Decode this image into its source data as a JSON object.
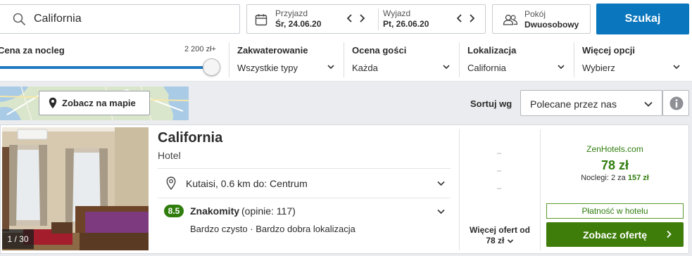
{
  "search": {
    "destination": "California"
  },
  "dates": {
    "checkin_label": "Przyjazd",
    "checkin_value": "Śr, 24.06.20",
    "checkout_label": "Wyjazd",
    "checkout_value": "Pt, 26.06.20"
  },
  "rooms": {
    "label": "Pokój",
    "value": "Dwuosobowy"
  },
  "search_button": "Szukaj",
  "filters": {
    "price_label": "Cena za nocleg",
    "price_max": "2 200 zł+",
    "price_slider_fraction": 1.0,
    "accommodation": {
      "title": "Zakwaterowanie",
      "value": "Wszystkie typy"
    },
    "rating": {
      "title": "Ocena gości",
      "value": "Każda"
    },
    "location": {
      "title": "Lokalizacja",
      "value": "California"
    },
    "more": {
      "title": "Więcej opcji",
      "value": "Wybierz"
    }
  },
  "map": {
    "button_label": "Zobacz na mapie"
  },
  "sort": {
    "label": "Sortuj wg",
    "value": "Polecane przez nas"
  },
  "hotel": {
    "name": "California",
    "type": "Hotel",
    "photo_counter": "1 / 30",
    "location": "Kutaisi, 0.6 km do: Centrum",
    "score": "8.5",
    "rating_word": "Znakomity",
    "rating_count": "(opinie: 117)",
    "highlights": "Bardzo czysto · Bardzo dobra lokalizacja",
    "placeholder_dashes": [
      "–",
      "–",
      "–"
    ],
    "more_offers_line1": "Więcej ofert od",
    "more_offers_line2": "78 zł",
    "provider": "ZenHotels.com",
    "price": "78 zł",
    "nights_prefix": "Noclegi: 2 za",
    "nights_total": "157 zł",
    "pay_at_hotel": "Płatność w hotelu",
    "cta": "Zobacz ofertę"
  },
  "colors": {
    "brand_blue": "#0a76bd",
    "deal_green": "#3f7d0a",
    "score_green": "#2f7d0d"
  }
}
